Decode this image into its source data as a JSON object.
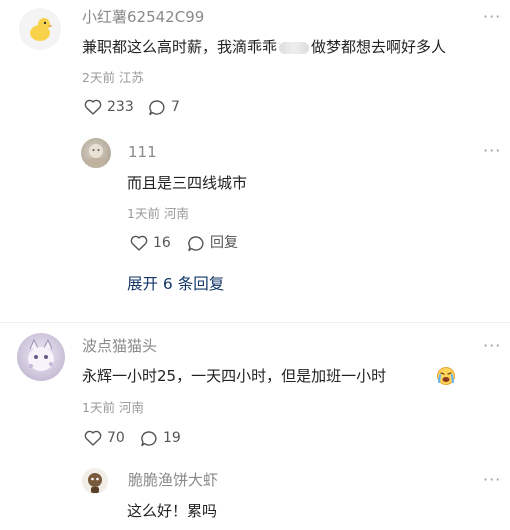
{
  "comments": [
    {
      "username": "小红薯62542C99",
      "avatar_icon": "yellow-duck-icon",
      "text": "兼职都这么高时薪，我滴乖乖",
      "text_tail": "做梦都想去啊好多人",
      "meta": "2天前 江苏",
      "likes": "233",
      "reply_count": "7",
      "replies": [
        {
          "username": "111",
          "text": "而且是三四线城市",
          "meta": "1天前 河南",
          "likes": "16",
          "reply_label": "回复"
        }
      ],
      "expand_label": "展开 6 条回复"
    },
    {
      "username": "波点猫猫头",
      "text": "永辉一小时25，一天四小时，但是加班一小时",
      "emoji_icon": "crying-face-icon",
      "meta": "1天前 河南",
      "likes": "70",
      "reply_count": "19",
      "replies": [
        {
          "username": "脆脆渔饼大虾",
          "text": "这么好！累吗"
        }
      ]
    }
  ],
  "more_icon_label": "···",
  "colors": {
    "link": "#133667",
    "muted": "#9a9a9a",
    "text": "#222222"
  }
}
